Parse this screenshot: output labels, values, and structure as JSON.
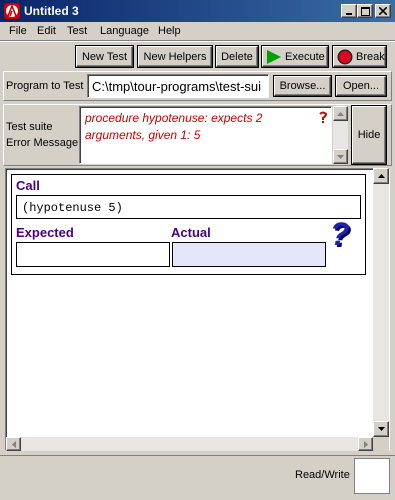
{
  "window": {
    "title": "Untitled 3"
  },
  "menu": [
    "File",
    "Edit",
    "Test",
    "Language",
    "Help"
  ],
  "toolbar": {
    "new_test": "New Test",
    "new_helpers": "New Helpers",
    "delete": "Delete",
    "execute": "Execute",
    "break": "Break"
  },
  "program": {
    "label": "Program to Test",
    "path": "C:\\tmp\\tour-programs\\test-sui",
    "browse": "Browse...",
    "open": "Open..."
  },
  "error": {
    "label_line1": "Test suite",
    "label_line2": "Error Message",
    "message_line1": "procedure hypotenuse: expects 2",
    "message_line2": "arguments, given 1: 5",
    "hide": "Hide"
  },
  "test_case": {
    "call_label": "Call",
    "call_expr": "(hypotenuse 5)",
    "expected_label": "Expected",
    "actual_label": "Actual",
    "expected_value": "",
    "actual_value": "",
    "result_symbol": "?"
  },
  "status": {
    "mode": "Read/Write"
  },
  "colors": {
    "accent_purple": "#4b0082",
    "error_red": "#cc0000",
    "execute_green": "#00a000",
    "break_red": "#e00020"
  }
}
